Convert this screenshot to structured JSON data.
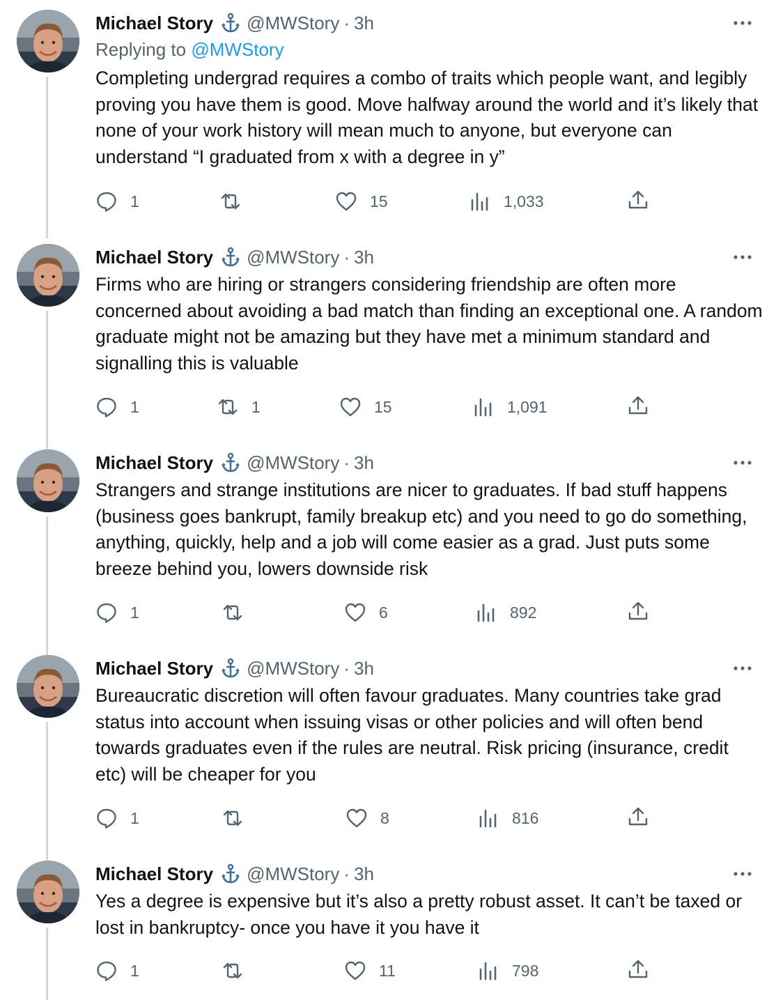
{
  "tweets": [
    {
      "name": "Michael Story",
      "handle": "@MWStory",
      "separator": "·",
      "time": "3h",
      "replying_label": "Replying to",
      "replying_handle": "@MWStory",
      "text": "Completing undergrad requires a combo of traits which people want, and legibly proving you have them is good. Move halfway around the world and it’s likely that none of your work history will mean much to anyone, but everyone can understand “I graduated from x with a degree in y”",
      "replies": "1",
      "retweets": "",
      "likes": "15",
      "views": "1,033"
    },
    {
      "name": "Michael Story",
      "handle": "@MWStory",
      "separator": "·",
      "time": "3h",
      "text": "Firms who are hiring or strangers considering friendship are often more concerned about avoiding a bad match than finding an exceptional one. A random graduate might not be amazing but they have met a minimum standard and signalling this is valuable",
      "replies": "1",
      "retweets": "1",
      "likes": "15",
      "views": "1,091"
    },
    {
      "name": "Michael Story",
      "handle": "@MWStory",
      "separator": "·",
      "time": "3h",
      "text": "Strangers and strange institutions are nicer to graduates. If bad stuff happens (business goes bankrupt, family breakup etc) and you need to go do something, anything, quickly, help and a job will come easier as a grad. Just puts some breeze behind you, lowers downside risk",
      "replies": "1",
      "retweets": "",
      "likes": "6",
      "views": "892"
    },
    {
      "name": "Michael Story",
      "handle": "@MWStory",
      "separator": "·",
      "time": "3h",
      "text": "Bureaucratic discretion will often favour graduates. Many countries take grad status into account when issuing visas or other policies and will often bend towards graduates even if the rules are neutral. Risk pricing (insurance, credit etc) will be cheaper for you",
      "replies": "1",
      "retweets": "",
      "likes": "8",
      "views": "816"
    },
    {
      "name": "Michael Story",
      "handle": "@MWStory",
      "separator": "·",
      "time": "3h",
      "text": "Yes a degree is expensive but it’s also a pretty robust asset. It can’t be taxed or lost in bankruptcy- once you have it you have it",
      "replies": "1",
      "retweets": "",
      "likes": "11",
      "views": "798"
    }
  ],
  "icons": {
    "badge": "anchor-icon",
    "more": "more-dots-icon",
    "reply": "reply-bubble-icon",
    "retweet": "retweet-icon",
    "like": "heart-icon",
    "views": "views-bar-chart-icon",
    "share": "share-upload-icon"
  },
  "colors": {
    "text": "#0f1419",
    "secondary": "#536471",
    "link": "#1d9bf0",
    "badge": "#3b6f9c",
    "thread_line": "#cfd9de"
  }
}
